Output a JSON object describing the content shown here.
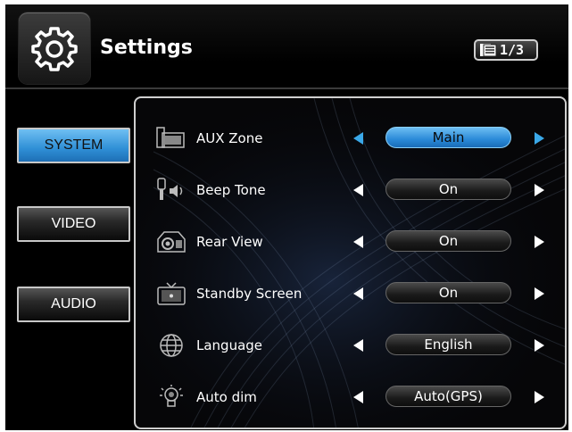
{
  "header": {
    "title": "Settings",
    "page_indicator": "1/3"
  },
  "tabs": [
    {
      "label": "SYSTEM",
      "selected": true
    },
    {
      "label": "VIDEO",
      "selected": false
    },
    {
      "label": "AUDIO",
      "selected": false
    }
  ],
  "settings": [
    {
      "label": "AUX Zone",
      "value": "Main",
      "icon": "aux-zone-icon",
      "active": true
    },
    {
      "label": "Beep Tone",
      "value": "On",
      "icon": "beep-tone-icon",
      "active": false
    },
    {
      "label": "Rear View",
      "value": "On",
      "icon": "rear-view-icon",
      "active": false
    },
    {
      "label": "Standby Screen",
      "value": "On",
      "icon": "standby-screen-icon",
      "active": false
    },
    {
      "label": "Language",
      "value": "English",
      "icon": "globe-icon",
      "active": false
    },
    {
      "label": "Auto dim",
      "value": "Auto(GPS)",
      "icon": "bulb-icon",
      "active": false
    }
  ],
  "colors": {
    "accent": "#2f8fd6",
    "accent_light": "#6fbff2",
    "background": "#000000"
  }
}
